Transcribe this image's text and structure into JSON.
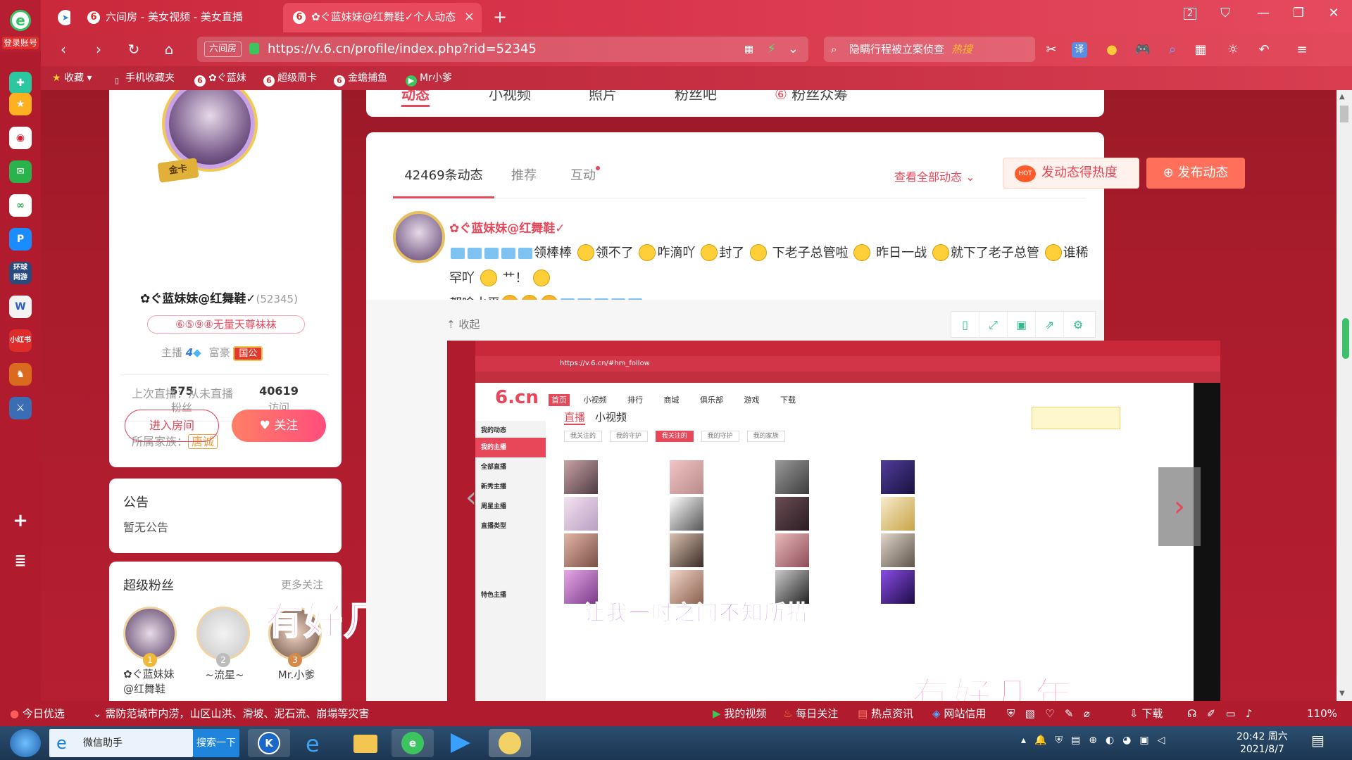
{
  "browser": {
    "login": "登录账号",
    "tabs": [
      {
        "label": "六间房 - 美女视频 - 美女直播",
        "icon": "6"
      },
      {
        "label": "✿ぐ蓝妹妹@红舞鞋✓个人动态",
        "icon": "6"
      }
    ],
    "url": "https://v.6.cn/profile/index.php?rid=52345",
    "url_tag": "六间房",
    "search": "隐瞒行程被立案侦查",
    "search_hot": "热搜",
    "window_count": "2"
  },
  "bookmarks": [
    {
      "label": "收藏",
      "icon": "★"
    },
    {
      "label": "手机收藏夹",
      "icon": "▯"
    },
    {
      "label": "✿ぐ蓝妹",
      "icon": "6"
    },
    {
      "label": "超级周卡",
      "icon": "6"
    },
    {
      "label": "金蟾捕鱼",
      "icon": "6"
    },
    {
      "label": "Mr小爹",
      "icon": "▶"
    }
  ],
  "nav_tabs": [
    "动态",
    "小视频",
    "照片",
    "粉丝吧",
    "粉丝众筹"
  ],
  "profile": {
    "gold_card": "金卡",
    "name": "✿ぐ蓝妹妹@红舞鞋✓",
    "rid": "(52345)",
    "title": "⑥⑤⑨⑧无量天尊袜袜",
    "anchor_label": "主播",
    "anchor_level": "4",
    "rich_label": "富豪",
    "rich_badge": "国公",
    "fans_count": "575",
    "fans_label": "粉丝",
    "visits_count": "40619",
    "visits_label": "访问",
    "family_label": "所属家族：",
    "family_badge": "唐诚",
    "last_live": "上次直播：从未直播",
    "enter_room": "进入房间",
    "follow": "关注"
  },
  "notice": {
    "title": "公告",
    "content": "暂无公告"
  },
  "superfans": {
    "title": "超级粉丝",
    "more": "更多关注",
    "fans": [
      {
        "rank": "1",
        "name": "✿ぐ蓝妹妹@红舞鞋"
      },
      {
        "rank": "2",
        "name": "~流星~"
      },
      {
        "rank": "3",
        "name": "Mr.小爹"
      }
    ]
  },
  "feed": {
    "tabs": [
      "42469条动态",
      "推荐",
      "互动"
    ],
    "view_all": "查看全部动态",
    "heat": "发动态得热度",
    "hot": "HOT",
    "publish": "发布动态",
    "post_author": "✿ぐ蓝妹妹@红舞鞋✓",
    "post_text": [
      "领棒棒",
      "领不了",
      "咋滴吖",
      "封了",
      "下老子总管啦",
      "昨日一战",
      "就下了老子总管",
      "谁稀罕吖",
      "艹！",
      "都啥水平"
    ],
    "collapse": "收起"
  },
  "overlays": {
    "big1": "有好几年",
    "big2": "有好几年",
    "subtitle": "让我一时之间不知所措"
  },
  "inner_shot": {
    "url": "https://v.6.cn/#hm_follow",
    "menu": [
      "首页",
      "小视频",
      "排行",
      "商城",
      "俱乐部",
      "游戏",
      "下载"
    ],
    "tabs": [
      "直播",
      "小视频"
    ],
    "filters": [
      "我关注的",
      "我的守护",
      "我关注的",
      "我的守护",
      "我的家族"
    ],
    "side": [
      "我的动态",
      "我的主播",
      "全部直播",
      "新秀主播",
      "周星主播",
      "直播类型",
      "特色主播"
    ]
  },
  "statusbar": {
    "left": "今日优选",
    "news": "需防范城市内涝，山区山洪、滑坡、泥石流、崩塌等灾害",
    "my_video": "我的视频",
    "daily": "每日关注",
    "hot_news": "热点资讯",
    "net": "网站信用",
    "download": "下载",
    "zoom": "110%"
  },
  "taskbar": {
    "wechat": "微信助手",
    "search": "搜索一下",
    "time": "20:42 周六",
    "date": "2021/8/7"
  },
  "colors": {
    "brand": "#e8475a",
    "chrome": "#c8283a",
    "accent": "#ff5b4d"
  }
}
